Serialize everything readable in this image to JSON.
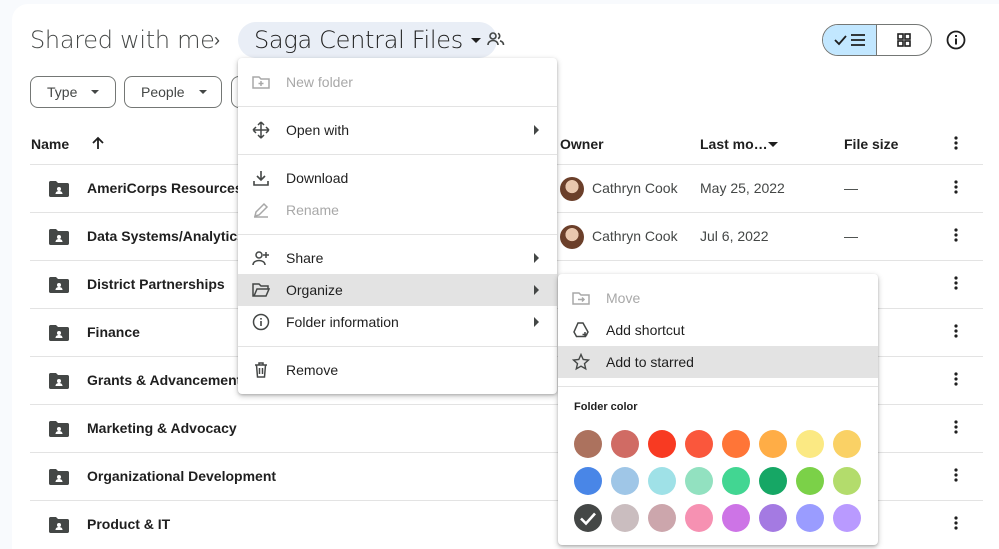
{
  "breadcrumb": {
    "root": "Shared with me",
    "current": "Saga Central Files"
  },
  "filters": [
    "Type",
    "People"
  ],
  "columns": {
    "name": "Name",
    "owner": "Owner",
    "modified": "Last mo…",
    "size": "File size"
  },
  "rows": [
    {
      "name": "AmeriCorps Resources",
      "owner": "Cathryn Cook",
      "modified": "May 25, 2022",
      "size": "—"
    },
    {
      "name": "Data Systems/Analytics",
      "owner": "Cathryn Cook",
      "modified": "Jul 6, 2022",
      "size": "—"
    },
    {
      "name": "District Partnerships",
      "owner": "",
      "modified": "",
      "size": ""
    },
    {
      "name": "Finance",
      "owner": "",
      "modified": "",
      "size": ""
    },
    {
      "name": "Grants & Advancement",
      "owner": "",
      "modified": "",
      "size": ""
    },
    {
      "name": "Marketing & Advocacy",
      "owner": "",
      "modified": "",
      "size": ""
    },
    {
      "name": "Organizational Development",
      "owner": "",
      "modified": "",
      "size": ""
    },
    {
      "name": "Product & IT",
      "owner": "",
      "modified": "",
      "size": ""
    }
  ],
  "context_menu": {
    "new_folder": "New folder",
    "open_with": "Open with",
    "download": "Download",
    "rename": "Rename",
    "share": "Share",
    "organize": "Organize",
    "folder_information": "Folder information",
    "remove": "Remove"
  },
  "organize_menu": {
    "move": "Move",
    "add_shortcut": "Add shortcut",
    "add_to_starred": "Add to starred",
    "folder_color_label": "Folder color",
    "colors": [
      "#ac725e",
      "#d06b64",
      "#f83a22",
      "#fa573c",
      "#ff7537",
      "#ffad46",
      "#fbe983",
      "#fad165",
      "#4986e7",
      "#9fc6e7",
      "#9fe1e7",
      "#92e1c0",
      "#42d692",
      "#16a765",
      "#7bd148",
      "#b3dc6c",
      "#444746",
      "#cabdbf",
      "#cca6ac",
      "#f691b2",
      "#cd74e6",
      "#a47ae2",
      "#9a9cff",
      "#b99aff"
    ],
    "selected_color_index": 16
  },
  "colors": {
    "accent": "#c2e7ff",
    "highlight": "#e3e3e3"
  }
}
